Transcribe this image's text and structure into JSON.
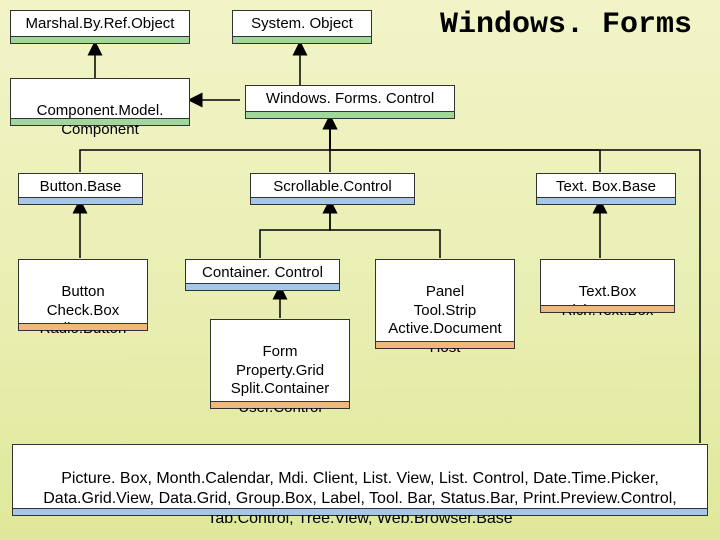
{
  "title": "Windows. Forms",
  "boxes": {
    "marshal": "Marshal.By.Ref.Object",
    "sysobj": "System. Object",
    "component": "Component.Model.\nComponent",
    "control": "Windows. Forms. Control",
    "buttonbase": "Button.Base",
    "scrollable": "Scrollable.Control",
    "textboxbase": "Text. Box.Base",
    "button_group": "Button\nCheck.Box\nRadio.Button",
    "container": "Container. Control",
    "panel_group": "Panel\nTool.Strip\nActive.Document\nHost",
    "textbox_group": "Text.Box\nRich.Text.Box",
    "form_group": "Form\nProperty.Grid\nSplit.Container\nUser.Control",
    "misc": "Picture. Box, Month.Calendar, Mdi. Client, List. View, List. Control, Date.Time.Picker,\nData.Grid.View, Data.Grid, Group.Box, Label, Tool. Bar, Status.Bar, Print.Preview.Control,\nTab.Control, Tree.View, Web.Browser.Base"
  }
}
